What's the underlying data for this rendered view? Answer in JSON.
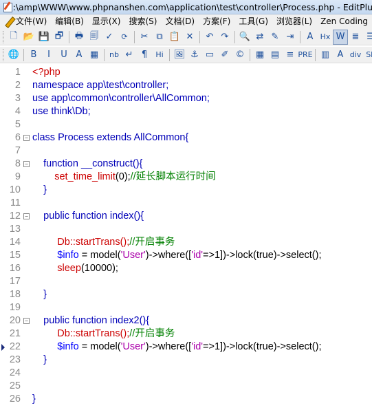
{
  "window": {
    "title": "D:\\amp\\WWW\\www.phpnanshen.com\\application\\test\\controller\\Process.php - EditPlus"
  },
  "menu": {
    "items": [
      "文件(W)",
      "编辑(B)",
      "显示(X)",
      "搜索(S)",
      "文档(D)",
      "方案(F)",
      "工具(G)",
      "浏览器(L)",
      "Zen Coding"
    ]
  },
  "toolbar1": {
    "buttons": [
      {
        "name": "new-file-icon",
        "glyph": "🗋"
      },
      {
        "name": "open-folder-icon",
        "glyph": "📂"
      },
      {
        "name": "save-icon",
        "glyph": "💾"
      },
      {
        "name": "save-all-icon",
        "glyph": "🗗"
      },
      {
        "name": "print-icon",
        "glyph": "🖶"
      },
      {
        "name": "print-preview-icon",
        "glyph": "🗐"
      },
      {
        "name": "spell-check-icon",
        "glyph": "✓"
      },
      {
        "name": "sync-icon",
        "glyph": "⟳"
      },
      {
        "name": "cut-icon",
        "glyph": "✂"
      },
      {
        "name": "copy-icon",
        "glyph": "⧉"
      },
      {
        "name": "paste-icon",
        "glyph": "📋"
      },
      {
        "name": "delete-icon",
        "glyph": "✕"
      },
      {
        "name": "undo-icon",
        "glyph": "↶"
      },
      {
        "name": "redo-icon",
        "glyph": "↷"
      },
      {
        "name": "find-icon",
        "glyph": "🔍"
      },
      {
        "name": "replace-icon",
        "glyph": "⇄"
      },
      {
        "name": "edit-icon",
        "glyph": "✎"
      },
      {
        "name": "indent-icon",
        "glyph": "⇥"
      },
      {
        "name": "font-size-icon",
        "glyph": "A"
      },
      {
        "name": "hex-icon",
        "glyph": "Hx"
      },
      {
        "name": "word-wrap-icon",
        "glyph": "W"
      },
      {
        "name": "fold-icon",
        "glyph": "≣"
      },
      {
        "name": "list-icon",
        "glyph": "☰"
      }
    ]
  },
  "toolbar2": {
    "buttons": [
      {
        "name": "browser-icon",
        "glyph": "🌐"
      },
      {
        "name": "bold-icon",
        "glyph": "B"
      },
      {
        "name": "italic-icon",
        "glyph": "I"
      },
      {
        "name": "underline-icon",
        "glyph": "U"
      },
      {
        "name": "font-color-icon",
        "glyph": "A"
      },
      {
        "name": "color-grid-icon",
        "glyph": "▦"
      },
      {
        "name": "nbsp-icon",
        "glyph": "nb"
      },
      {
        "name": "line-break-icon",
        "glyph": "↵"
      },
      {
        "name": "paragraph-icon",
        "glyph": "¶"
      },
      {
        "name": "heading-icon",
        "glyph": "Hi"
      },
      {
        "name": "image-icon",
        "glyph": "🖼"
      },
      {
        "name": "anchor-icon",
        "glyph": "⚓"
      },
      {
        "name": "hr-icon",
        "glyph": "▭"
      },
      {
        "name": "highlight-icon",
        "glyph": "✐"
      },
      {
        "name": "copyright-icon",
        "glyph": "©"
      },
      {
        "name": "table-icon",
        "glyph": "▦"
      },
      {
        "name": "form-icon",
        "glyph": "▤"
      },
      {
        "name": "align-icon",
        "glyph": "≡"
      },
      {
        "name": "pre-icon",
        "glyph": "PRE"
      },
      {
        "name": "block-icon",
        "glyph": "▥"
      },
      {
        "name": "font-icon",
        "glyph": "A"
      },
      {
        "name": "div-icon",
        "glyph": "div"
      },
      {
        "name": "span-icon",
        "glyph": "SP"
      }
    ]
  },
  "editor": {
    "current_line": 22,
    "lines": [
      {
        "n": "1",
        "fold": "",
        "tokens": [
          {
            "c": "t-tag",
            "t": "<?php"
          }
        ]
      },
      {
        "n": "2",
        "fold": "",
        "tokens": [
          {
            "c": "t-bl",
            "t": "namespace app\\test\\controller;"
          }
        ]
      },
      {
        "n": "3",
        "fold": "",
        "tokens": [
          {
            "c": "t-bl",
            "t": "use app\\common\\controller\\AllCommon;"
          }
        ]
      },
      {
        "n": "4",
        "fold": "",
        "tokens": [
          {
            "c": "t-bl",
            "t": "use think\\Db;"
          }
        ]
      },
      {
        "n": "5",
        "fold": "",
        "tokens": []
      },
      {
        "n": "6",
        "fold": "⊟",
        "tokens": [
          {
            "c": "t-bl",
            "t": "class Process extends AllCommon{"
          }
        ]
      },
      {
        "n": "7",
        "fold": "",
        "tokens": []
      },
      {
        "n": "8",
        "fold": "⊟",
        "tokens": [
          {
            "c": "t-pl",
            "t": "    "
          },
          {
            "c": "t-bl",
            "t": "function __construct(){"
          }
        ]
      },
      {
        "n": "9",
        "fold": "",
        "tokens": [
          {
            "c": "t-pl",
            "t": "        "
          },
          {
            "c": "t-fn",
            "t": "set_time_limit"
          },
          {
            "c": "t-nav",
            "t": "(0);"
          },
          {
            "c": "t-cm",
            "t": "//延长脚本运行时间"
          }
        ]
      },
      {
        "n": "10",
        "fold": "",
        "tokens": [
          {
            "c": "t-pl",
            "t": "    "
          },
          {
            "c": "t-bl",
            "t": "}"
          }
        ]
      },
      {
        "n": "11",
        "fold": "",
        "tokens": []
      },
      {
        "n": "12",
        "fold": "⊟",
        "tokens": [
          {
            "c": "t-pl",
            "t": "    "
          },
          {
            "c": "t-bl",
            "t": "public function index(){"
          }
        ]
      },
      {
        "n": "13",
        "fold": "",
        "tokens": []
      },
      {
        "n": "14",
        "fold": "",
        "tokens": [
          {
            "c": "t-pl",
            "t": "         "
          },
          {
            "c": "t-tag",
            "t": "Db::startTrans();"
          },
          {
            "c": "t-cm",
            "t": "//开启事务"
          }
        ]
      },
      {
        "n": "15",
        "fold": "",
        "tokens": [
          {
            "c": "t-pl",
            "t": "         "
          },
          {
            "c": "t-var",
            "t": "$info"
          },
          {
            "c": "t-nav",
            "t": " = model("
          },
          {
            "c": "t-str",
            "t": "'User'"
          },
          {
            "c": "t-nav",
            "t": ")->where(["
          },
          {
            "c": "t-str",
            "t": "'id'"
          },
          {
            "c": "t-nav",
            "t": "=>1])->lock(true)->select();"
          }
        ]
      },
      {
        "n": "16",
        "fold": "",
        "tokens": [
          {
            "c": "t-pl",
            "t": "         "
          },
          {
            "c": "t-fn",
            "t": "sleep"
          },
          {
            "c": "t-nav",
            "t": "(10000);"
          }
        ]
      },
      {
        "n": "17",
        "fold": "",
        "tokens": []
      },
      {
        "n": "18",
        "fold": "",
        "tokens": [
          {
            "c": "t-pl",
            "t": "    "
          },
          {
            "c": "t-bl",
            "t": "}"
          }
        ]
      },
      {
        "n": "19",
        "fold": "",
        "tokens": []
      },
      {
        "n": "20",
        "fold": "⊟",
        "tokens": [
          {
            "c": "t-pl",
            "t": "    "
          },
          {
            "c": "t-bl",
            "t": "public function index2(){"
          }
        ]
      },
      {
        "n": "21",
        "fold": "",
        "tokens": [
          {
            "c": "t-pl",
            "t": "         "
          },
          {
            "c": "t-tag",
            "t": "Db::startTrans();"
          },
          {
            "c": "t-cm",
            "t": "//开启事务"
          }
        ]
      },
      {
        "n": "22",
        "fold": "",
        "tokens": [
          {
            "c": "t-pl",
            "t": "         "
          },
          {
            "c": "t-var",
            "t": "$info"
          },
          {
            "c": "t-nav",
            "t": " = model("
          },
          {
            "c": "t-str",
            "t": "'User'"
          },
          {
            "c": "t-nav",
            "t": ")->where(["
          },
          {
            "c": "t-str",
            "t": "'id'"
          },
          {
            "c": "t-nav",
            "t": "=>1])->lock(true)->select();"
          }
        ]
      },
      {
        "n": "23",
        "fold": "",
        "tokens": [
          {
            "c": "t-pl",
            "t": "    "
          },
          {
            "c": "t-bl",
            "t": "}"
          }
        ]
      },
      {
        "n": "24",
        "fold": "",
        "tokens": []
      },
      {
        "n": "25",
        "fold": "",
        "tokens": []
      },
      {
        "n": "26",
        "fold": "",
        "tokens": [
          {
            "c": "t-bl",
            "t": "}"
          }
        ]
      }
    ]
  }
}
